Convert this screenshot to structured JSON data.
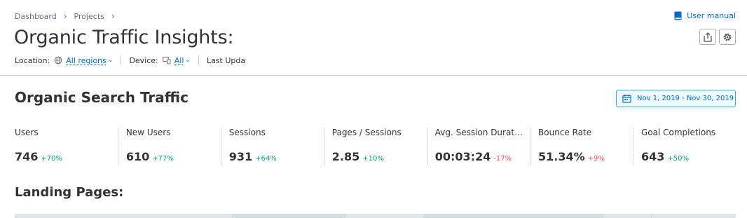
{
  "breadcrumb": {
    "items": [
      "Dashboard",
      "Projects"
    ],
    "separator": "›"
  },
  "page": {
    "title": "Organic Traffic Insights:"
  },
  "filters": {
    "location_label": "Location:",
    "location_value": "All regions",
    "device_label": "Device:",
    "device_value": "All",
    "last_update_label": "Last Update"
  },
  "header_actions": {
    "user_manual": "User manual",
    "share_icon": "share-icon",
    "settings_icon": "gear-icon"
  },
  "section": {
    "title": "Organic Search Traffic",
    "date_range": "Nov 1, 2019 - Nov 30, 2019"
  },
  "metrics": [
    {
      "label": "Users",
      "value": "746",
      "delta": "+70%",
      "trend": "positive"
    },
    {
      "label": "New Users",
      "value": "610",
      "delta": "+77%",
      "trend": "positive"
    },
    {
      "label": "Sessions",
      "value": "931",
      "delta": "+64%",
      "trend": "positive"
    },
    {
      "label": "Pages / Sessions",
      "value": "2.85",
      "delta": "+10%",
      "trend": "positive"
    },
    {
      "label": "Avg. Session Durat…",
      "value": "00:03:24",
      "delta": "-17%",
      "trend": "negative"
    },
    {
      "label": "Bounce Rate",
      "value": "51.34%",
      "delta": "+9%",
      "trend": "negative"
    },
    {
      "label": "Goal Completions",
      "value": "643",
      "delta": "+50%",
      "trend": "positive"
    }
  ],
  "landing": {
    "title": "Landing Pages:"
  },
  "colors": {
    "link": "#006dca",
    "positive": "#009f81",
    "negative": "#ff4953",
    "accent_border": "#2bb3d1"
  }
}
